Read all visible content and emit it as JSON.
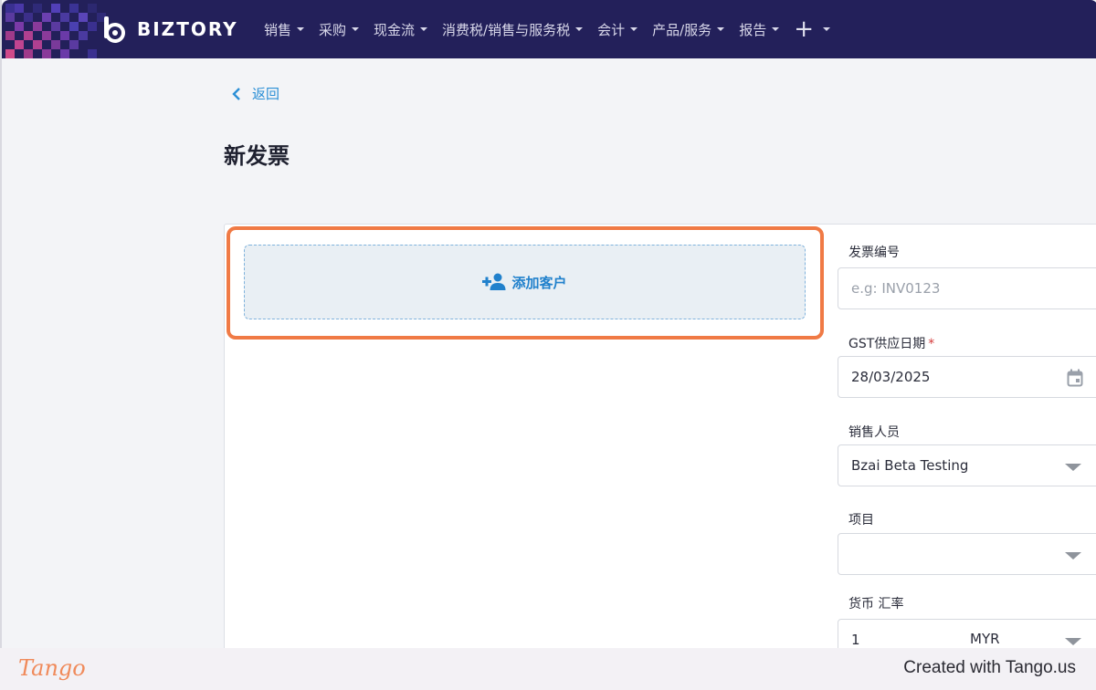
{
  "navbar": {
    "brand": "BIZTORY",
    "menu": [
      {
        "label": "销售"
      },
      {
        "label": "采购"
      },
      {
        "label": "现金流"
      },
      {
        "label": "消费税/销售与服务税"
      },
      {
        "label": "会计"
      },
      {
        "label": "产品/服务"
      },
      {
        "label": "报告"
      }
    ],
    "plus_icon": "plus-icon"
  },
  "back_label": "返回",
  "page_title": "新发票",
  "customer": {
    "add_label": "添加客户",
    "icon": "add-person-icon"
  },
  "form": {
    "invoice_number": {
      "label": "发票编号",
      "placeholder": "e.g: INV0123",
      "value": ""
    },
    "gst_date": {
      "label": "GST供应日期",
      "required": "*",
      "value": "28/03/2025",
      "icon": "calendar-icon"
    },
    "salesperson": {
      "label": "销售人员",
      "value": "Bzai Beta Testing"
    },
    "project": {
      "label": "项目",
      "value": ""
    },
    "currency": {
      "label": "货币 汇率",
      "rate": "1",
      "code": "MYR"
    }
  },
  "footer": {
    "logo": "Tango",
    "credit": "Created with Tango.us"
  },
  "colors": {
    "navbar": "#23205a",
    "link": "#2b8fd6",
    "highlight": "#f07a45",
    "add_customer_bg": "#e9eff4"
  }
}
